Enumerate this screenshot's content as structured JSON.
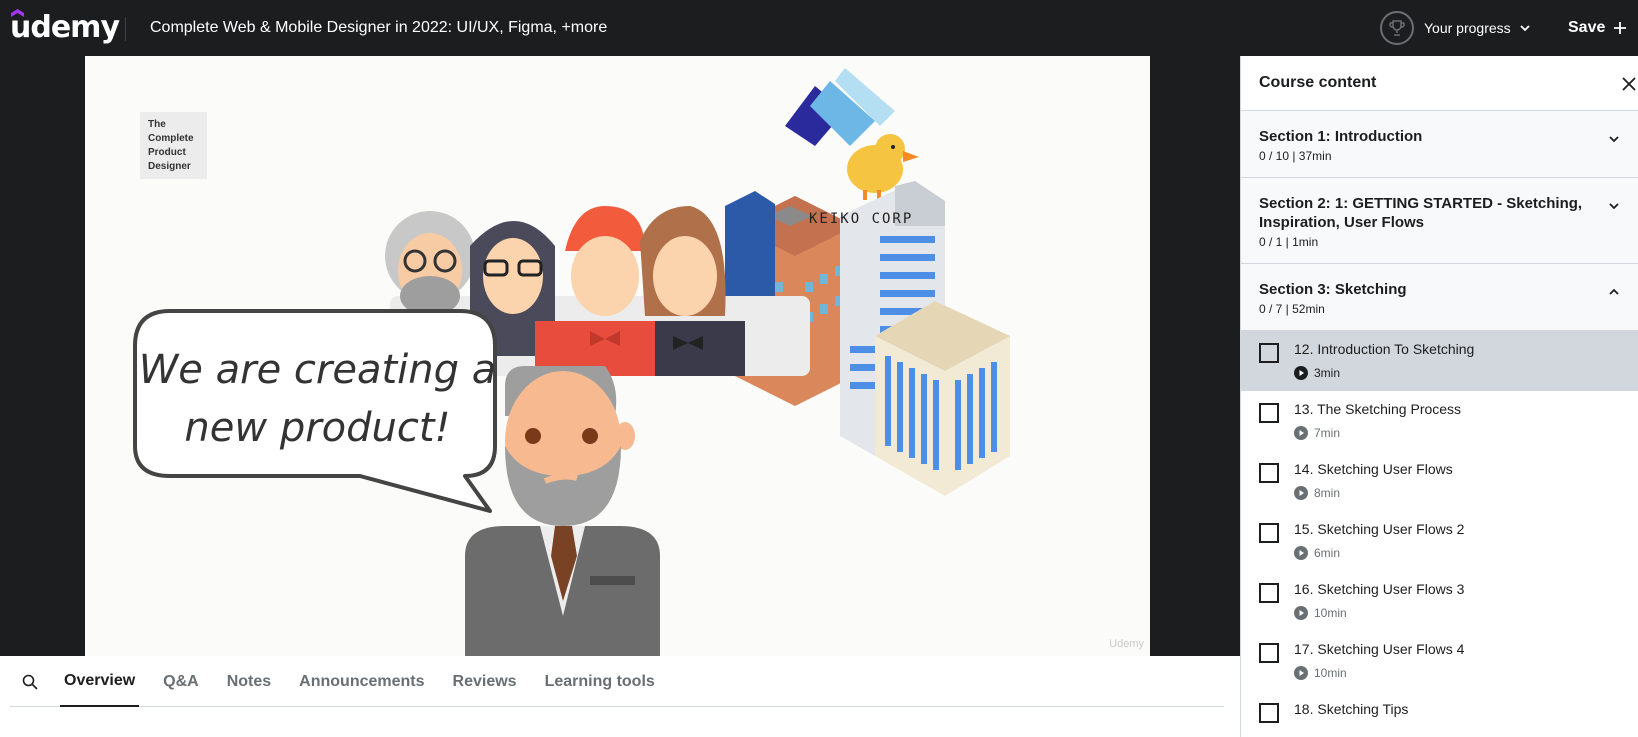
{
  "header": {
    "logo": "udemy",
    "course_title": "Complete Web & Mobile Designer in 2022: UI/UX, Figma, +more",
    "progress_label": "Your progress",
    "save_label": "Save"
  },
  "video": {
    "brand_card": [
      "The",
      "Complete",
      "Product",
      "Designer"
    ],
    "company_label": "KEIKO CORP",
    "bubble_text": [
      "We are creating a",
      "new product!"
    ],
    "watermark": "Udemy"
  },
  "tabs": [
    "Overview",
    "Q&A",
    "Notes",
    "Announcements",
    "Reviews",
    "Learning tools"
  ],
  "sidebar": {
    "title": "Course content",
    "sections": [
      {
        "title": "Section 1: Introduction",
        "meta": "0 / 10 | 37min",
        "expanded": false
      },
      {
        "title": "Section 2: 1: GETTING STARTED - Sketching, Inspiration, User Flows",
        "meta": "0 / 1 | 1min",
        "expanded": false
      },
      {
        "title": "Section 3: Sketching",
        "meta": "0 / 7 | 52min",
        "expanded": true
      }
    ],
    "lessons": [
      {
        "title": "12. Introduction To Sketching",
        "duration": "3min",
        "current": true
      },
      {
        "title": "13. The Sketching Process",
        "duration": "7min"
      },
      {
        "title": "14. Sketching User Flows",
        "duration": "8min"
      },
      {
        "title": "15. Sketching User Flows 2",
        "duration": "6min"
      },
      {
        "title": "16. Sketching User Flows 3",
        "duration": "10min"
      },
      {
        "title": "17. Sketching User Flows 4",
        "duration": "10min"
      },
      {
        "title": "18. Sketching Tips",
        "duration": ""
      }
    ]
  },
  "colors": {
    "header_bg": "#1c1d1f",
    "sidebar_section_bg": "#f7f9fa",
    "current_lesson_bg": "#d1d7dc",
    "accent": "#a435f0"
  },
  "icons": {
    "progress": "trophy-icon",
    "save": "plus-icon",
    "close": "close-icon",
    "search": "search-icon",
    "lesson": "play-circle-icon"
  }
}
